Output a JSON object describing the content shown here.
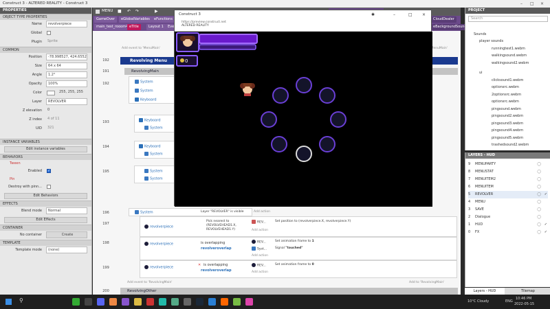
{
  "window": {
    "title": "Construct 3 - ALTERED REALITY - Construct 3"
  },
  "properties": {
    "header": "PROPERTIES",
    "object_type_section": "OBJECT TYPE PROPERTIES",
    "name_label": "Name",
    "name_value": "revolverpiece",
    "global_label": "Global",
    "plugin_label": "Plugin",
    "plugin_value": "Sprite",
    "common_section": "COMMON",
    "position_label": "Position",
    "position_value": "-78.998527, 424.6552",
    "size_label": "Size",
    "size_value": "64 x 64",
    "angle_label": "Angle",
    "angle_value": "1.2°",
    "opacity_label": "Opacity",
    "opacity_value": "100%",
    "color_label": "Color",
    "color_value": "255, 255, 255",
    "layer_label": "Layer",
    "layer_value": "REVOLVER",
    "zelev_label": "Z elevation",
    "zelev_value": "0",
    "zindex_label": "Z index",
    "zindex_value": "4 of 11",
    "uid_label": "UID",
    "uid_value": "321",
    "instance_section": "INSTANCE VARIABLES",
    "edit_instance_btn": "Edit instance variables",
    "behaviors_section": "BEHAVIORS",
    "tween_label": "Tween",
    "enabled_label": "Enabled",
    "pin_label": "Pin",
    "destroy_label": "Destroy with pinn...",
    "edit_behaviors_btn": "Edit Behaviors",
    "effects_section": "EFFECTS",
    "blend_label": "Blend mode",
    "blend_value": "Normal",
    "edit_effects_btn": "Edit Effects",
    "container_section": "CONTAINER",
    "no_container_label": "No container",
    "create_btn": "Create",
    "template_section": "TEMPLATE",
    "template_label": "Template mode",
    "template_value": "(none)"
  },
  "toolbar": {
    "menu": "MENU"
  },
  "tabs": [
    "GameOver",
    "eGlobalVariables",
    "eFunctions",
    "eSounds",
    "main_test_rooom4",
    "eTitle",
    "Layout 1",
    "Eve"
  ],
  "tab_right": [
    "CloudDealer",
    "eBackgroundSounds"
  ],
  "events": {
    "add_event_top": "Add event to 'MenuMain'",
    "add_event_right": "Add event to 'MenuMain'",
    "group_revolving": "Revolving Menu",
    "sub_revolving_main": "RevolvingMain",
    "row_nums": [
      "192",
      "191",
      "192",
      "193",
      "194",
      "195",
      "196",
      "197",
      "198",
      "199",
      "200"
    ],
    "system": "System",
    "keyboard": "Keyboard",
    "layer_visible": "Layer \"REVOLVER\" is visible",
    "revolverpiece": "revolverpiece",
    "pick_nearest": "Pick nearest to (REVOLVEHEAD1.X, REVOLVEHEAD1.Y)",
    "set_position": "Set position to (revolverpiece.X, revolverpiece.Y)",
    "is_overlapping": "is overlapping",
    "revolveroverlap": "revolveroverlap",
    "set_anim_1": "Set animation frame to",
    "frame_1": "1",
    "signal": "Signal",
    "touched": "\"touched\"",
    "set_anim_0": "Set animation frame to",
    "frame_0": "0",
    "add_action": "Add action",
    "add_event_bottom": "Add event to 'RevolvingMain'",
    "add_event_bottom_right": "Add to 'RevolvingMain'",
    "group_other": "RevolvingOther",
    "rev_short": "REV...",
    "syst_short": "Syst..."
  },
  "preview": {
    "title": "Construct 3",
    "url": "https://preview.construct.net",
    "subtitle": "ALTERED REALITY",
    "counter": "0"
  },
  "project": {
    "header": "PROJECT",
    "search_placeholder": "Search",
    "sounds": "Sounds",
    "player_sounds": "player sounds",
    "player_files": [
      "runningtest1.webm",
      "walkingsound.webm",
      "walkingsound2.webm"
    ],
    "ui": "ui",
    "ui_files": [
      "clicksound1.webm",
      "optionsrc.webm",
      "2optionsrc.webm",
      "optionsrc.webm",
      "pingsound.webm",
      "pingsound2.webm",
      "pingsound3.webm",
      "pingsound4.webm",
      "pingsound5.webm",
      "trashedsound.webm",
      "trashedsound2.webm"
    ]
  },
  "layers": {
    "header": "LAYERS - HUD",
    "items": [
      {
        "n": "9",
        "name": "MENUPARTY"
      },
      {
        "n": "8",
        "name": "MENUSTAT"
      },
      {
        "n": "7",
        "name": "MENUITEM2"
      },
      {
        "n": "6",
        "name": "MENUITEM"
      },
      {
        "n": "5",
        "name": "REVOLVER"
      },
      {
        "n": "4",
        "name": "MENU"
      },
      {
        "n": "3",
        "name": "SAVE"
      },
      {
        "n": "2",
        "name": "Dialogue"
      },
      {
        "n": "1",
        "name": "HUD"
      },
      {
        "n": "0",
        "name": "FX"
      }
    ],
    "bottom_tab": "Layers - HUD",
    "bottom_tab2": "Tilemap"
  },
  "taskbar": {
    "weather": "10°C Cloudy",
    "lang": "ENG",
    "time": "10:46 PM",
    "date": "2022-05-15"
  },
  "colors": {
    "accent": "#6b4a8a",
    "group": "#1a3a8f",
    "ring": "#6a3fd6"
  }
}
